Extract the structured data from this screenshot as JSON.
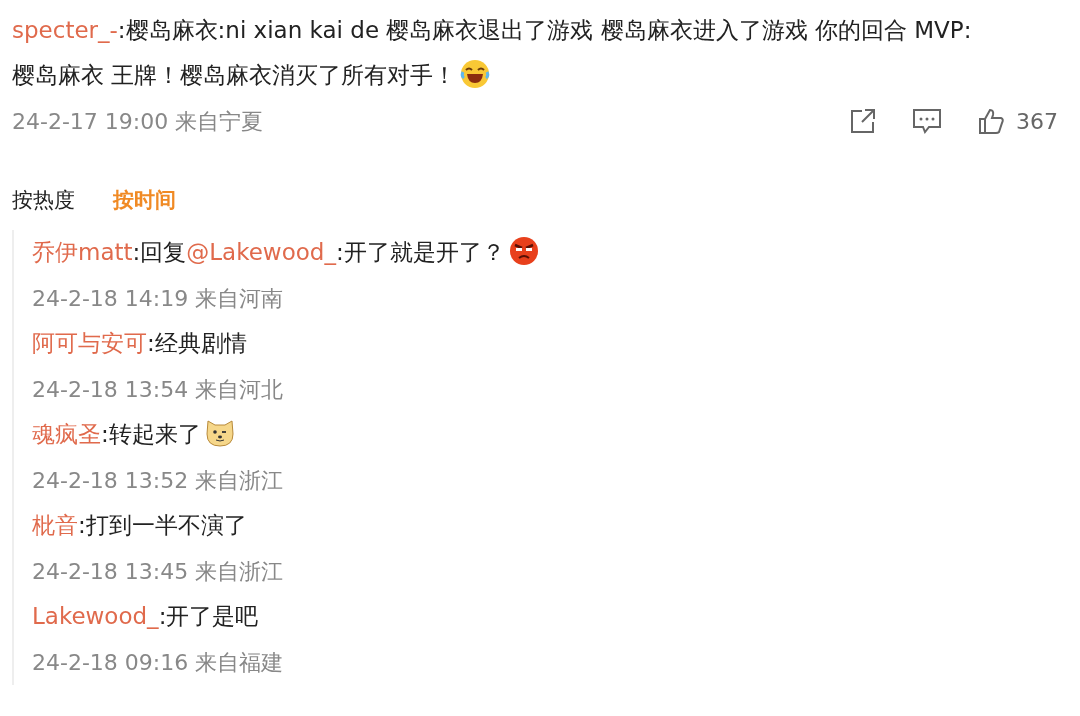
{
  "comment": {
    "author": "specter_-",
    "parts": [
      {
        "kind": "text",
        "text": ":樱岛麻衣:ni xian kai de 樱岛麻衣退出了游戏 樱岛麻衣进入了游戏 你的回合 MVP:樱岛麻衣 王牌！樱岛麻衣消灭了所有对手！"
      },
      {
        "kind": "laugh"
      }
    ],
    "time": "24-2-17 19:00 来自宁夏",
    "likes": "367"
  },
  "sort_tabs": [
    {
      "label": "按热度",
      "selected": false
    },
    {
      "label": "按时间",
      "selected": true
    }
  ],
  "replies": [
    {
      "author": "乔伊matt",
      "parts": [
        {
          "kind": "text",
          "text": ":回复"
        },
        {
          "kind": "mention",
          "text": "@Lakewood_"
        },
        {
          "kind": "text",
          "text": ":开了就是开了？"
        },
        {
          "kind": "angry"
        }
      ],
      "time": "24-2-18 14:19 来自河南"
    },
    {
      "author": "阿可与安可",
      "parts": [
        {
          "kind": "text",
          "text": ":经典剧情"
        }
      ],
      "time": "24-2-18 13:54 来自河北"
    },
    {
      "author": "魂疯圣",
      "parts": [
        {
          "kind": "text",
          "text": ":转起来了"
        },
        {
          "kind": "dog"
        }
      ],
      "time": "24-2-18 13:52 来自浙江"
    },
    {
      "author": "枇音",
      "parts": [
        {
          "kind": "text",
          "text": ":打到一半不演了"
        }
      ],
      "time": "24-2-18 13:45 来自浙江"
    },
    {
      "author": "Lakewood_",
      "parts": [
        {
          "kind": "text",
          "text": ":开了是吧"
        }
      ],
      "time": "24-2-18 09:16 来自福建"
    }
  ]
}
